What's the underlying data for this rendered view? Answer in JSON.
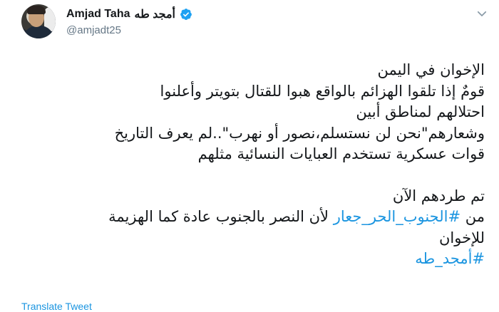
{
  "author": {
    "display_name_en": "Amjad Taha",
    "display_name_ar": "أمجد طه",
    "handle": "@amjadt25",
    "verified_icon": "verified-badge-icon",
    "avatar_icon": "profile-photo"
  },
  "menu_icon": "chevron-down-icon",
  "tweet": {
    "lines": [
      "الإخوان في اليمن",
      "قومٌ إذا تلقوا الهزائم بالواقع هبوا للقتال بتويتر وأعلنوا",
      "احتلالهم لمناطق أبين",
      "وشعارهم\"نحن لن نستسلم،نصور أو نهرب\"..لم يعرف التاريخ",
      "قوات عسكرية تستخدم العبايات النسائية مثلهم",
      "تم طردهم الآن"
    ],
    "line7_prefix": "من ",
    "hashtag_1": "#الجنوب_الحر_جعار",
    "line7_suffix": " لأن النصر بالجنوب عادة كما الهزيمة",
    "line8": "للإخوان",
    "hashtag_2": "#أمجد_طه"
  },
  "translate_label": "Translate Tweet",
  "colors": {
    "link": "#1b95e0",
    "text": "#14171a",
    "secondary": "#657786",
    "verified": "#1da1f2"
  }
}
